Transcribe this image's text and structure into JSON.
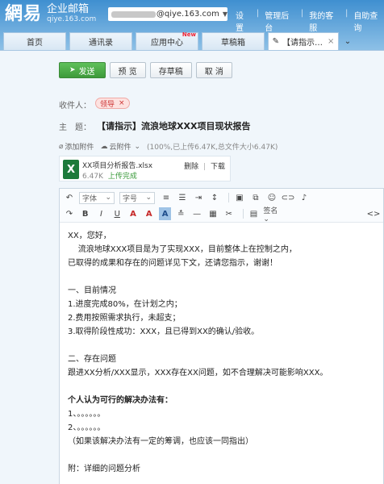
{
  "header": {
    "logo_mark": "網易",
    "logo_title": "企业邮箱",
    "logo_sub": "qiye.163.com",
    "user_domain": "@qiye.163.com",
    "links": [
      "设置",
      "管理后台",
      "我的客服",
      "自助查询"
    ]
  },
  "tabs": [
    {
      "label": "首页"
    },
    {
      "label": "通讯录"
    },
    {
      "label": "应用中心",
      "badge": "New"
    },
    {
      "label": "草稿箱"
    },
    {
      "label": "【请指示…"
    }
  ],
  "actions": {
    "send": "发送",
    "preview": "预 览",
    "save_draft": "存草稿",
    "cancel": "取 消"
  },
  "recipient": {
    "label": "收件人：",
    "chip": "领导"
  },
  "subject": {
    "label": "主　题：",
    "value": "【请指示】流浪地球XXX项目现状报告"
  },
  "attachments": {
    "add_label": "添加附件",
    "cloud_label": "云附件",
    "status": "(100%,已上传6.47K,总文件大小6.47K)",
    "file": {
      "name": "XX项目分析报告.xlsx",
      "size": "6.47K",
      "status": "上传完成",
      "delete": "删除",
      "download": "下载"
    }
  },
  "toolbar": {
    "font": "字体",
    "size": "字号",
    "signature": "签名"
  },
  "body_lines": [
    "XX，您好，",
    "    流浪地球XXX项目是为了实现XXX，目前整体上在控制之内，",
    "已取得的成果和存在的问题详见下文，还请您指示，谢谢！",
    "",
    "一、目前情况",
    "1.进度完成80%，在计划之内；",
    "2.费用按照需求执行，未超支；",
    "3.取得阶段性成功：XXX，且已得到XX的确认/验收。",
    "",
    "二、存在问题",
    "跟进XX分析/XXX显示，XXX存在XX问题，如不合理解决可能影响XXX。",
    "",
    "个人认为可行的解决办法有：",
    "1、。。。。。。",
    "2、。。。。。。",
    "（如果该解决办法有一定的筹调，也应该一同指出）",
    "",
    "附：详细的问题分析"
  ],
  "colors": {
    "send_green": "#3e9a3a",
    "header_blue": "#3f8fd0",
    "chip_red": "#c33333"
  }
}
